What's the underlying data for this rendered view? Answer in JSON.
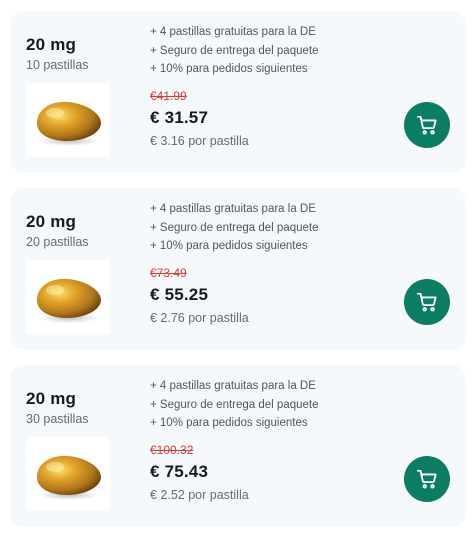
{
  "colors": {
    "card_background": "#f5f9fc",
    "cart_button": "#0a7d62",
    "old_price": "#d53c3c",
    "pill_gold": "#c8901c"
  },
  "icons": {
    "pill": "pill-image",
    "cart": "shopping-cart-icon"
  },
  "offers": [
    {
      "dose": "20 mg",
      "quantity": "10 pastillas",
      "benefits": [
        "+ 4 pastillas gratuitas para la DE",
        "+ Seguro de entrega del paquete",
        "+ 10% para pedidos siguientes"
      ],
      "old_price": "€41.99",
      "price": "€ 31.57",
      "per_pill": "€ 3.16 por pastilla"
    },
    {
      "dose": "20 mg",
      "quantity": "20 pastillas",
      "benefits": [
        "+ 4 pastillas gratuitas para la DE",
        "+ Seguro de entrega del paquete",
        "+ 10% para pedidos siguientes"
      ],
      "old_price": "€73.49",
      "price": "€ 55.25",
      "per_pill": "€ 2.76 por pastilla"
    },
    {
      "dose": "20 mg",
      "quantity": "30 pastillas",
      "benefits": [
        "+ 4 pastillas gratuitas para la DE",
        "+ Seguro de entrega del paquete",
        "+ 10% para pedidos siguientes"
      ],
      "old_price": "€100.32",
      "price": "€ 75.43",
      "per_pill": "€ 2.52 por pastilla"
    }
  ]
}
